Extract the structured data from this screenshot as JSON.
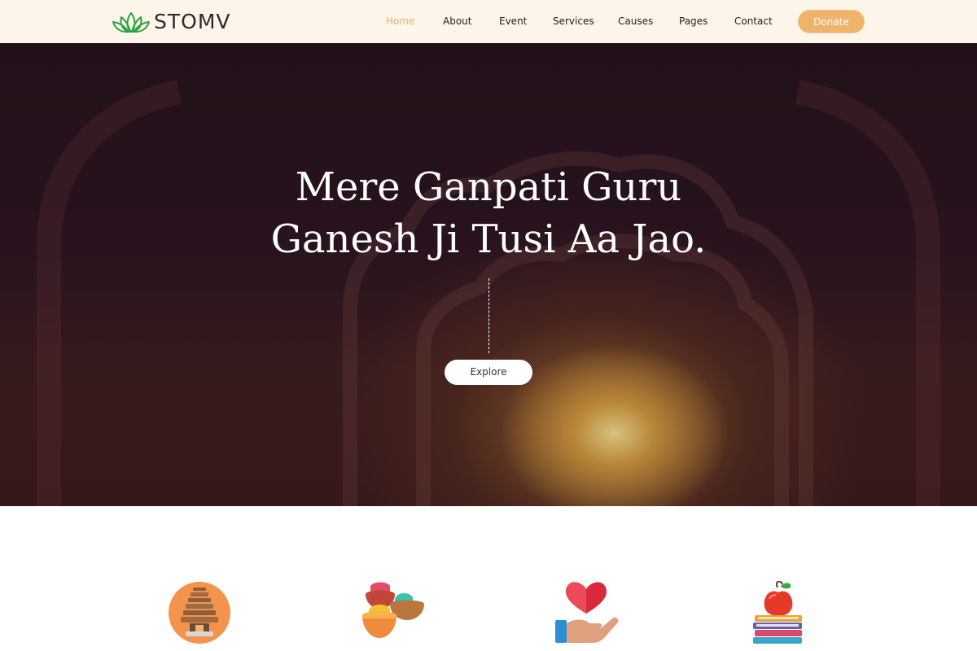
{
  "brand": {
    "name": "STOMV",
    "icon": "lotus-logo-icon",
    "logo_color": "#2ea043"
  },
  "nav": {
    "items": [
      {
        "label": "Home",
        "active": true
      },
      {
        "label": "About",
        "active": false
      },
      {
        "label": "Event",
        "active": false
      },
      {
        "label": "Services",
        "active": false
      },
      {
        "label": "Causes",
        "active": false
      },
      {
        "label": "Pages",
        "active": false
      },
      {
        "label": "Contact",
        "active": false
      }
    ],
    "donate_label": "Donate",
    "active_color": "#e8b36a",
    "accent_color": "#efb46a"
  },
  "hero": {
    "title_line1": "Mere Ganpati Guru",
    "title_line2": "Ganesh Ji Tusi Aa Jao.",
    "button_label": "Explore"
  },
  "features": {
    "icons": [
      "temple-icon",
      "color-powder-bowls-icon",
      "heart-in-hand-icon",
      "apple-on-books-icon"
    ]
  }
}
